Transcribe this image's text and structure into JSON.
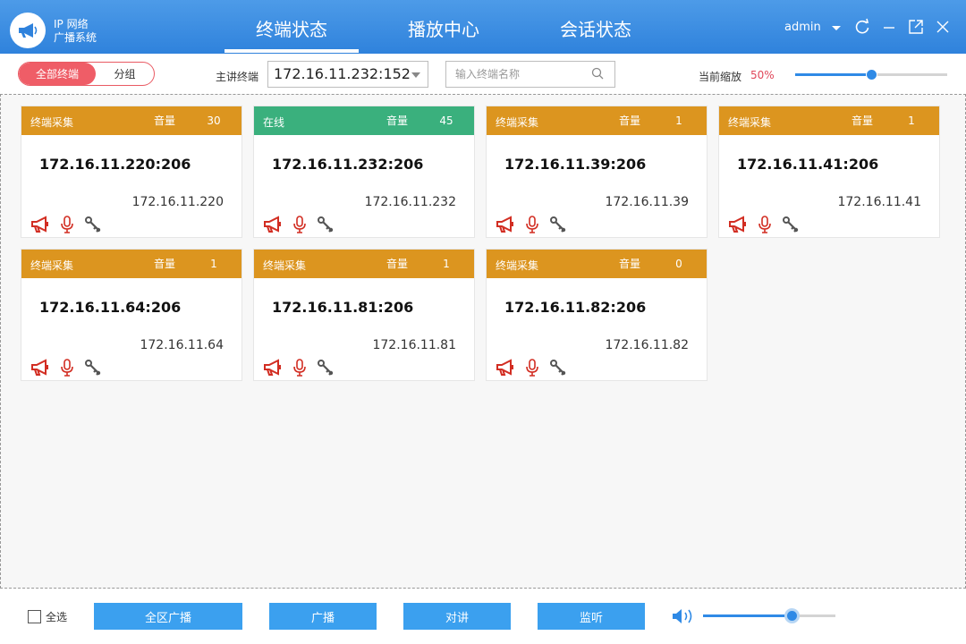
{
  "header": {
    "app_title_line1": "IP 网络",
    "app_title_line2": "广播系统",
    "tabs": [
      "终端状态",
      "播放中心",
      "会话状态"
    ],
    "active_tab": "终端状态",
    "user": "admin"
  },
  "toolbar": {
    "seg_all": "全部终端",
    "seg_group": "分组",
    "host_label": "主讲终端",
    "host_value": "172.16.11.232:152",
    "search_placeholder": "输入终端名称",
    "zoom_label": "当前缩放",
    "zoom_value": "50%",
    "zoom_fraction": 0.5
  },
  "colors": {
    "accent": "#2f82dc",
    "collecting": "#dc951f",
    "online": "#3ab07d",
    "alert": "#e0475a",
    "button": "#3ba0ef"
  },
  "icons": [
    "broadcast-icon",
    "microphone-icon",
    "key-icon"
  ],
  "terminals": [
    {
      "status": "终端采集",
      "volume_label": "音量",
      "volume": "30",
      "name": "172.16.11.220:206",
      "ip": "172.16.11.220",
      "online": false
    },
    {
      "status": "在线",
      "volume_label": "音量",
      "volume": "45",
      "name": "172.16.11.232:206",
      "ip": "172.16.11.232",
      "online": true
    },
    {
      "status": "终端采集",
      "volume_label": "音量",
      "volume": "1",
      "name": "172.16.11.39:206",
      "ip": "172.16.11.39",
      "online": false
    },
    {
      "status": "终端采集",
      "volume_label": "音量",
      "volume": "1",
      "name": "172.16.11.41:206",
      "ip": "172.16.11.41",
      "online": false
    },
    {
      "status": "终端采集",
      "volume_label": "音量",
      "volume": "1",
      "name": "172.16.11.64:206",
      "ip": "172.16.11.64",
      "online": false
    },
    {
      "status": "终端采集",
      "volume_label": "音量",
      "volume": "1",
      "name": "172.16.11.81:206",
      "ip": "172.16.11.81",
      "online": false
    },
    {
      "status": "终端采集",
      "volume_label": "音量",
      "volume": "0",
      "name": "172.16.11.82:206",
      "ip": "172.16.11.82",
      "online": false
    }
  ],
  "footer": {
    "select_all": "全选",
    "buttons": [
      "全区广播",
      "广播",
      "对讲",
      "监听"
    ],
    "volume_fraction": 0.67
  }
}
